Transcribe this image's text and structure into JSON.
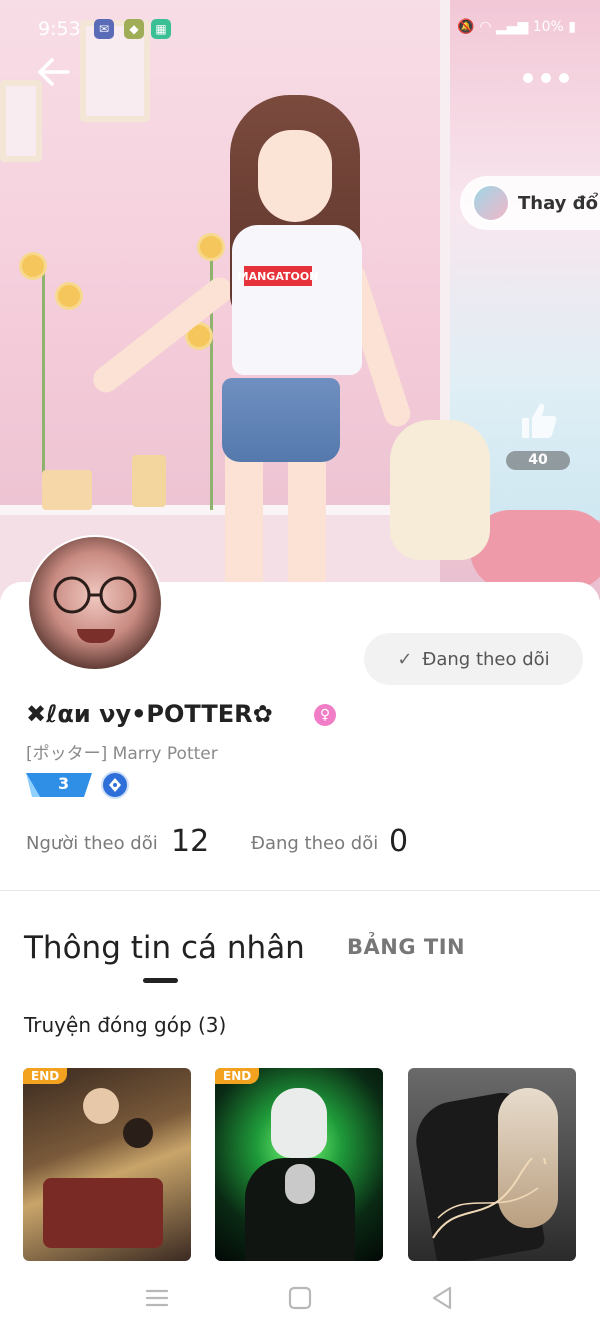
{
  "status_bar": {
    "time": "9:53",
    "battery": "10%"
  },
  "header": {
    "back_icon": "arrow-left-icon",
    "more_icon": "more-dots-icon",
    "change_label": "Thay đổ",
    "like_count": "40"
  },
  "profile": {
    "name": "✖ℓαи νу•POTTER✿",
    "subname": "[ポッター] Marry Potter",
    "level": "3",
    "follow_button_label": "Đang theo dõi",
    "followers_label": "Người theo dõi",
    "followers_count": "12",
    "following_label": "Đang theo dõi",
    "following_count": "0"
  },
  "tabs": [
    {
      "label": "Thông tin cá nhân",
      "active": true
    },
    {
      "label": "BẢNG TIN",
      "active": false
    }
  ],
  "contributions": {
    "title": "Truyện đóng góp (3)",
    "books": [
      {
        "badge": "END"
      },
      {
        "badge": "END"
      },
      {
        "badge": ""
      }
    ]
  },
  "colors": {
    "accent": "#f2a21e",
    "level_badge": "#2f8ee6",
    "gender_badge": "#f07dc6"
  }
}
